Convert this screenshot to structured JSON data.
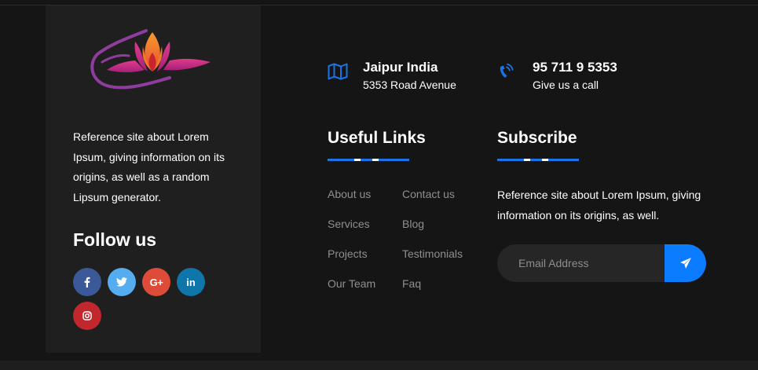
{
  "about": {
    "text": "Reference site about Lorem Ipsum, giving information on its origins, as well as a random Lipsum generator."
  },
  "follow": {
    "title": "Follow us",
    "social": [
      {
        "name": "facebook-icon",
        "glyph": "f",
        "color": "#3b5998"
      },
      {
        "name": "twitter-icon",
        "glyph": "",
        "color": "#55acee"
      },
      {
        "name": "google-plus-icon",
        "glyph": "G+",
        "color": "#dd4b39"
      },
      {
        "name": "linkedin-icon",
        "glyph": "in",
        "color": "#0e76a8"
      },
      {
        "name": "instagram-icon",
        "glyph": "",
        "color": "#c1272d"
      }
    ]
  },
  "contacts": [
    {
      "icon": "map-icon",
      "title": "Jaipur India",
      "subtitle": "5353 Road Avenue"
    },
    {
      "icon": "phone-icon",
      "title": "95 711 9 5353",
      "subtitle": "Give us a call"
    }
  ],
  "useful_links": {
    "title": "Useful Links",
    "col1": [
      "About us",
      "Services",
      "Projects",
      "Our Team"
    ],
    "col2": [
      "Contact us",
      "Blog",
      "Testimonials",
      "Faq"
    ]
  },
  "subscribe": {
    "title": "Subscribe",
    "text": "Reference site about Lorem Ipsum, giving information on its origins, as well.",
    "placeholder": "Email Address"
  },
  "colors": {
    "accent": "#0b7bff",
    "panel": "#1f1f1f",
    "background": "#151515",
    "link": "#8f8f8f"
  }
}
